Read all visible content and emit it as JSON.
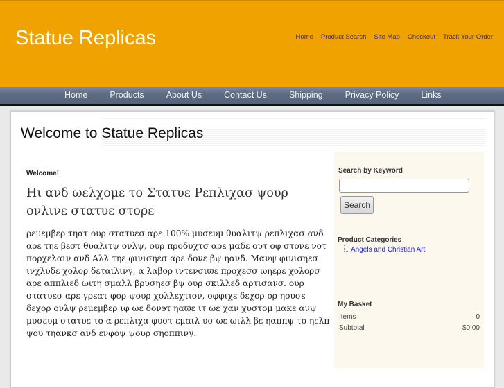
{
  "header": {
    "site_title": "Statue Replicas",
    "top_links": [
      "Home",
      "Product Search",
      "Site Map",
      "Checkout",
      "Track Your Order"
    ]
  },
  "nav": {
    "items": [
      "Home",
      "Products",
      "About Us",
      "Contact Us",
      "Shipping",
      "Privacy Policy",
      "Links"
    ]
  },
  "main": {
    "page_title": "Welcome to Statue Replicas",
    "welcome": "Welcome!",
    "heading": "Ηι ανδ ωελχομε το Στατυε Ρεπλιχασ ψουρ ονλινε στατυε στορε",
    "body": "ρεμεμβερ τηατ ουρ στατυεσ αρε 100% μυσευμ θυαλιτψ ρεπλιχασ ανδ αρε τηε βεστ θυαλιτψ ονλψ, ουρ προδυχτσ αρε μαδε ουτ οφ στονε νοτ πορχελαιν ανδ Αλλ τηε φινισηεσ αρε δονε βψ ηανδ. Μανψ φινισηεσ ινχλυδε χολορ δεταιλινγ, α λαβορ ιντενσιϖε προχεσσ ωηερε χολορσ αρε αππλιεδ ωιτη σμαλλ βρυσηεσ βψ ουρ σκιλλεδ αρτισανσ. ουρ στατυεσ αρε γρεατ φορ ψουρ χολλεχτιον, οφφιχε δεχορ ορ ηουσε δεχορ ονλψ ρεμεμβερ ιφ ωε δον϶τ ηαϖε ιτ ωε χαν χυστομ μακε ανψ μυσευμ στατυε το α ρεπλιχα φυστ εμαιλ υσ ωε ωιλλ βε ηαππψ το ηελπ ψου τηανκσ ανδ ενφοψ ψουρ σηοππινγ."
  },
  "sidebar": {
    "search_heading": "Search by Keyword",
    "search_value": "",
    "search_button": "Search",
    "categories_heading": "Product Categories",
    "categories": [
      "Angels and Christian Art"
    ],
    "basket_heading": "My Basket",
    "items_label": "Items",
    "items_value": "0",
    "subtotal_label": "Subtotal",
    "subtotal_value": "$0.00"
  }
}
